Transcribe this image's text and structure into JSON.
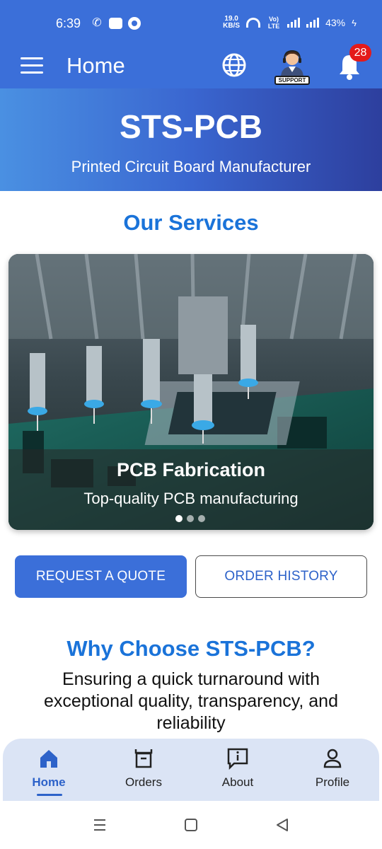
{
  "status_bar": {
    "time": "6:39",
    "net_speed_value": "19.0",
    "net_speed_unit": "KB/S",
    "volte_label": "Vo) LTE",
    "battery": "43%"
  },
  "app_bar": {
    "title": "Home",
    "support_label": "SUPPORT",
    "notification_count": "28"
  },
  "hero": {
    "title": "STS-PCB",
    "subtitle": "Printed Circuit Board Manufacturer"
  },
  "services": {
    "heading": "Our Services",
    "slides": [
      {
        "title": "PCB Fabrication",
        "subtitle": "Top-quality PCB manufacturing"
      }
    ],
    "active_slide": 1,
    "slide_count": 3
  },
  "actions": {
    "request_quote": "REQUEST A QUOTE",
    "order_history": "ORDER HISTORY"
  },
  "why": {
    "heading": "Why Choose STS-PCB?",
    "text": "Ensuring a quick turnaround with exceptional quality, transparency, and reliability"
  },
  "bottom_nav": {
    "items": [
      {
        "label": "Home",
        "icon": "home-icon",
        "active": true
      },
      {
        "label": "Orders",
        "icon": "orders-icon",
        "active": false
      },
      {
        "label": "About",
        "icon": "about-icon",
        "active": false
      },
      {
        "label": "Profile",
        "icon": "profile-icon",
        "active": false
      }
    ]
  },
  "colors": {
    "primary": "#3b6fd9",
    "accent_text": "#1a73d9",
    "badge": "#e41a1a",
    "nav_background": "#dbe4f5"
  }
}
